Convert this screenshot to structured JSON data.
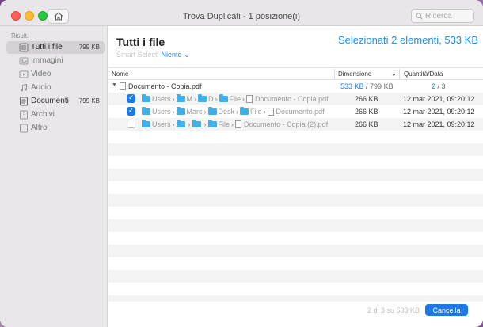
{
  "window": {
    "title": "Trova Duplicati - 1 posizione(i)"
  },
  "search": {
    "placeholder": "Ricerca"
  },
  "sidebar": {
    "header": "Risult.",
    "items": [
      {
        "label": "Tutti i file",
        "size": "799 KB",
        "icon": "all-files-icon",
        "active": true
      },
      {
        "label": "Immagini",
        "size": "",
        "icon": "image-icon",
        "active": false
      },
      {
        "label": "Video",
        "size": "",
        "icon": "video-icon",
        "active": false
      },
      {
        "label": "Audio",
        "size": "",
        "icon": "music-icon",
        "active": false
      },
      {
        "label": "Documenti",
        "size": "799 KB",
        "icon": "document-icon",
        "active": false
      },
      {
        "label": "Archivi",
        "size": "",
        "icon": "archive-icon",
        "active": false
      },
      {
        "label": "Altro",
        "size": "",
        "icon": "other-icon",
        "active": false
      }
    ]
  },
  "main": {
    "title": "Tutti i file",
    "smart_select_label": "Smart Select:",
    "smart_select_value": "Niente",
    "selected_summary": "Selezionati 2 elementi, 533 KB",
    "columns": {
      "name": "Nome",
      "size": "Dimensione",
      "quantity": "Quantità/Data"
    },
    "group": {
      "name": "Documento - Copia.pdf",
      "size_selected": "533 KB",
      "size_total": "/ 799 KB",
      "qty_selected": "2",
      "qty_total": "/ 3"
    },
    "files": [
      {
        "checked": true,
        "path": [
          "Users",
          "M",
          "D",
          "File"
        ],
        "filename": "Documento - Copia.pdf",
        "size": "266 KB",
        "date": "12 mar 2021, 09:20:12"
      },
      {
        "checked": true,
        "path": [
          "Users",
          "Marc",
          "Desk",
          "File"
        ],
        "filename": "Documento.pdf",
        "size": "266 KB",
        "date": "12 mar 2021, 09:20:12"
      },
      {
        "checked": false,
        "path": [
          "Users",
          "",
          "",
          "File"
        ],
        "filename": "Documento - Copia (2).pdf",
        "size": "266 KB",
        "date": "12 mar 2021, 09:20:12"
      }
    ]
  },
  "footer": {
    "status": "2 di 3 su 533 KB",
    "cancel_label": "Cancella"
  },
  "colors": {
    "accent": "#1e78e6",
    "folder": "#3fb0e8",
    "summary": "#1f8fe8"
  }
}
